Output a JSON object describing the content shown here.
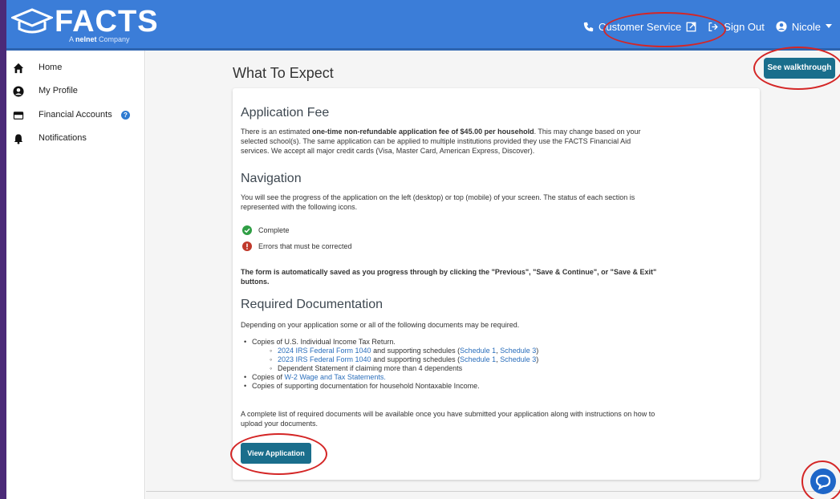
{
  "header": {
    "logo_text": "FACTS",
    "logo_tagline_prefix": "A ",
    "logo_tagline_brand": "nelnet",
    "logo_tagline_suffix": " Company",
    "customer_service": "Customer Service",
    "sign_out": "Sign Out",
    "user_name": "Nicole",
    "bg_color": "#3b7dd8"
  },
  "sidebar": {
    "items": [
      {
        "label": "Home",
        "icon": "home-icon"
      },
      {
        "label": "My Profile",
        "icon": "user-circle-icon"
      },
      {
        "label": "Financial Accounts",
        "icon": "credit-card-icon",
        "help": "?"
      },
      {
        "label": "Notifications",
        "icon": "bell-icon"
      }
    ]
  },
  "main": {
    "title": "What To Expect",
    "walkthrough_button": "See walkthrough",
    "sections": {
      "fee_heading": "Application Fee",
      "fee_text_1": "There is an estimated ",
      "fee_text_bold": "one-time non-refundable application fee of $45.00 per household",
      "fee_text_2": ". This may change based on your selected school(s). The same application can be applied to multiple institutions provided they use the FACTS Financial Aid services. We accept all major credit cards (Visa, Master Card, American Express, Discover).",
      "nav_heading": "Navigation",
      "nav_text": "You will see the progress of the application on the left (desktop) or top (mobile) of your screen. The status of each section is represented with the following icons.",
      "status_complete": "Complete",
      "status_errors": "Errors that must be corrected",
      "autosave_text": "The form is automatically saved as you progress through by clicking the \"Previous\", \"Save & Continue\", or \"Save & Exit\" buttons.",
      "docs_heading": "Required Documentation",
      "docs_intro": "Depending on your application some or all of the following documents may be required.",
      "docs_item_1": "Copies of U.S. Individual Income Tax Return.",
      "docs_sub_1_link": "2024 IRS Federal Form 1040",
      "docs_sub_2_link": "2023 IRS Federal Form 1040",
      "docs_sub_mid": " and supporting schedules (",
      "schedule_1": "Schedule 1",
      "comma": ", ",
      "schedule_3": "Schedule 3",
      "close_paren": ")",
      "docs_sub_3": "Dependent Statement if claiming more than 4 dependents",
      "docs_item_2_prefix": "Copies of ",
      "docs_item_2_link": "W-2 Wage and Tax Statements.",
      "docs_item_3": "Copies of supporting documentation for household Nontaxable Income.",
      "closing_text": "A complete list of required documents will be available once you have submitted your application along with instructions on how to upload your documents."
    },
    "view_button": "View Application"
  },
  "colors": {
    "accent_button": "#1a6e8c",
    "complete_green": "#2f9e44",
    "error_red": "#c0392b",
    "annotation_red": "#d42626",
    "link_blue": "#2a6ebb"
  }
}
